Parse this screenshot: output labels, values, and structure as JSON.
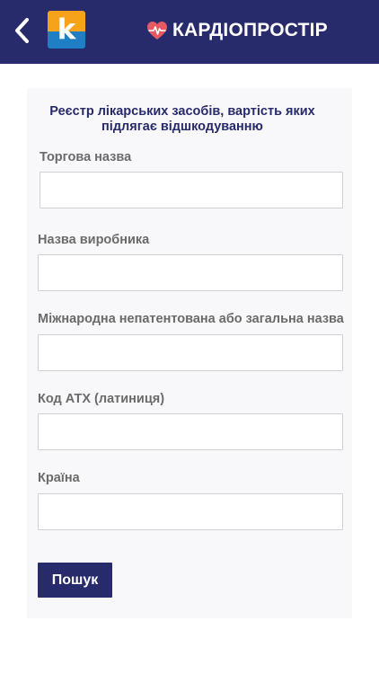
{
  "header": {
    "logo_letter": "k",
    "brand_name": "КАРДІОПРОСТІР",
    "colors": {
      "background": "#272a6b",
      "heart": "#e85a63",
      "logo_top": "#f7a21b",
      "logo_bottom": "#1f7fc4"
    },
    "icons": [
      "chevron-left-icon",
      "heart-pulse-icon"
    ]
  },
  "form": {
    "title": "Реєстр лікарських засобів, вартість яких підлягає відшкодуванню",
    "fields": [
      {
        "label": "Торгова назва",
        "value": ""
      },
      {
        "label": "Назва виробника",
        "value": ""
      },
      {
        "label": "Міжнародна непатентована або загальна назва",
        "value": ""
      },
      {
        "label": "Код АТХ (латиниця)",
        "value": ""
      },
      {
        "label": "Країна",
        "value": ""
      }
    ],
    "submit_label": "Пошук"
  }
}
